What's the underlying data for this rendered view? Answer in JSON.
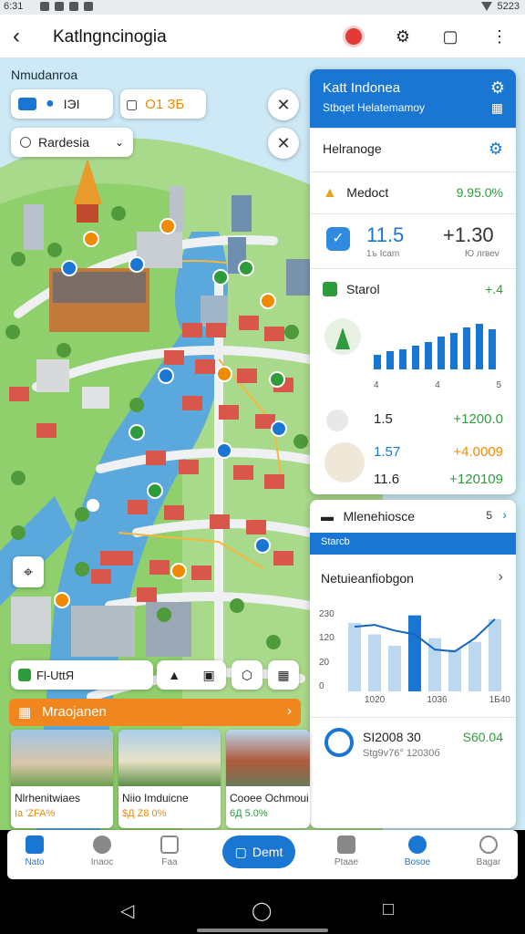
{
  "status": {
    "time": "6:31",
    "battery": "5223"
  },
  "appbar": {
    "title": "Katlngncinogia"
  },
  "map": {
    "section_label": "Nmudanroa",
    "chip_left_value": "IЭI",
    "chip_right_value": "O1 ЗБ",
    "select_value": "Rardesia"
  },
  "panel": {
    "title": "Katt Indonea",
    "subtitle": "Stbqet Helatemamoy",
    "section_title": "Helranoge",
    "row1_label": "Medoct",
    "row1_value": "9.95.0%",
    "stat_left_value": "11.5",
    "stat_left_sub": "1ъ  Icam",
    "stat_right_value": "+1.30",
    "stat_right_sub": "Ю лrвеv",
    "trend_label": "Starol",
    "trend_value": "+.4",
    "axis_ticks": [
      "4",
      "4",
      "5"
    ],
    "list": [
      {
        "a": "1.5",
        "b": "+1200.0"
      },
      {
        "a": "1.57",
        "b": "+4.0009"
      },
      {
        "a": "11.6",
        "b": "+120109"
      }
    ]
  },
  "panel2": {
    "title": "Mlenehiosce",
    "pager": "5",
    "tab": "Starcb",
    "chart_title": "Netuieanfiobgon",
    "yticks": [
      "230",
      "120",
      "20",
      "0"
    ],
    "xticks": [
      "1020",
      "1036",
      "1Б40"
    ],
    "summary_value": "SI2008 30",
    "summary_sub": "Stg9v76° 12030б",
    "summary_right": "S60.04"
  },
  "chart_data": {
    "type": "bar",
    "categories": [
      "1",
      "2",
      "3",
      "4",
      "5",
      "6",
      "7",
      "8"
    ],
    "series": [
      {
        "values": [
          180,
          150,
          120,
          200,
          140,
          110,
          130,
          190
        ]
      }
    ],
    "ylim": [
      0,
      240
    ],
    "line": [
      170,
      175,
      160,
      150,
      110,
      105,
      140,
      190
    ]
  },
  "toolbar_row": {
    "label": "Fl-UttЯ"
  },
  "carousel": {
    "header": "Mraojanen",
    "cards": [
      {
        "title": "Nlrhenitwiaes",
        "sub": "Ia 'ZFA%"
      },
      {
        "title": "Niio Imduicne",
        "sub": "$Д Z8 0%"
      },
      {
        "title": "Cooee Ochmoui",
        "sub": "6Д  5.0%"
      }
    ]
  },
  "nav": {
    "items": [
      "Nato",
      "Inaoc",
      "Faa",
      "Ptaae",
      "Bosoe",
      "Bagar"
    ],
    "fab_label": "Demt"
  },
  "colors": {
    "primary": "#1976d2",
    "accent": "#f0861e",
    "positive": "#2e9b3c"
  }
}
